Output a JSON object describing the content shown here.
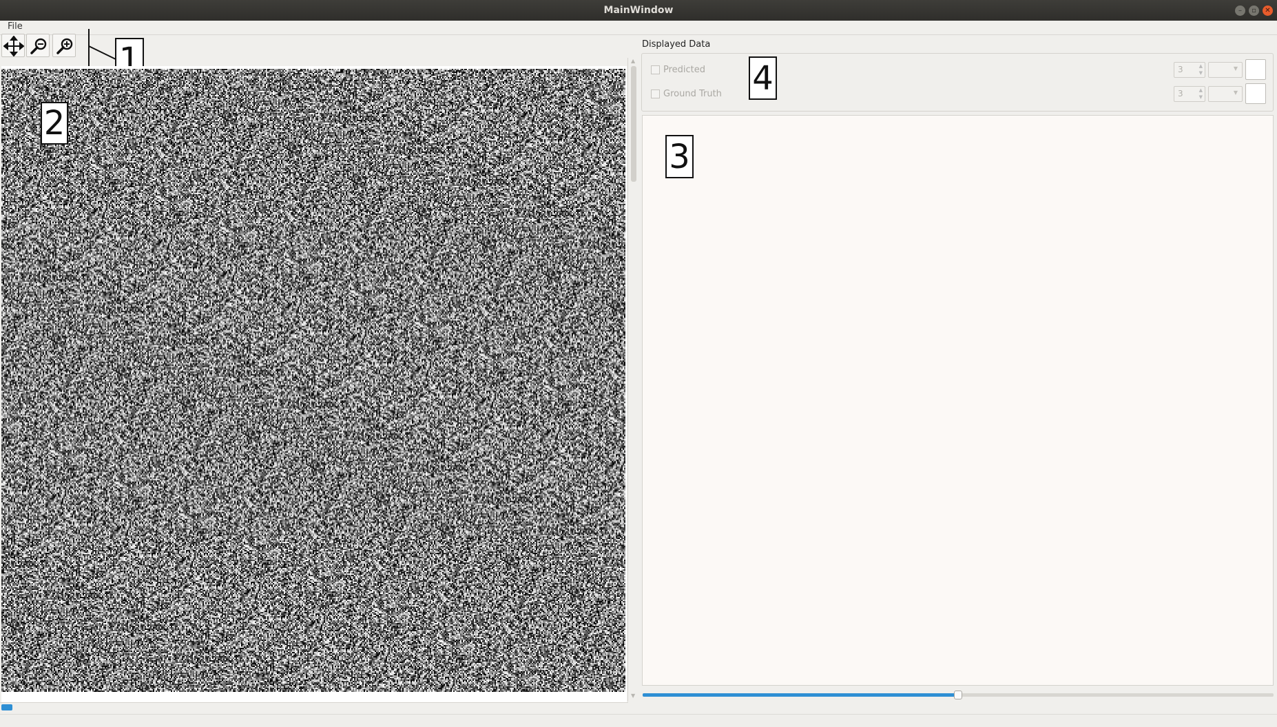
{
  "window": {
    "title": "MainWindow",
    "buttons": [
      "minimize",
      "maximize",
      "close"
    ]
  },
  "menu": {
    "items": [
      "File"
    ]
  },
  "toolbar": {
    "tools": [
      {
        "name": "pan",
        "icon": "move-arrows-icon"
      },
      {
        "name": "zoom-out",
        "icon": "zoom-out-icon"
      },
      {
        "name": "zoom-in",
        "icon": "zoom-in-icon"
      }
    ]
  },
  "annotations": [
    "1",
    "2",
    "3",
    "4"
  ],
  "displayed_data": {
    "title": "Displayed Data",
    "rows": [
      {
        "label": "Predicted",
        "checked": false,
        "spin_value": "3",
        "combo_value": "",
        "color": "#ffffff"
      },
      {
        "label": "Ground Truth",
        "checked": false,
        "spin_value": "3",
        "combo_value": "",
        "color": "#ffffff"
      }
    ]
  },
  "image_view": {
    "content": "random noise image"
  },
  "slider": {
    "fraction": 0.5
  },
  "colors": {
    "accent": "#2e8fd4",
    "titlebar": "#3a3935",
    "close": "#e85c2c",
    "panel": "#fcf9f6"
  }
}
